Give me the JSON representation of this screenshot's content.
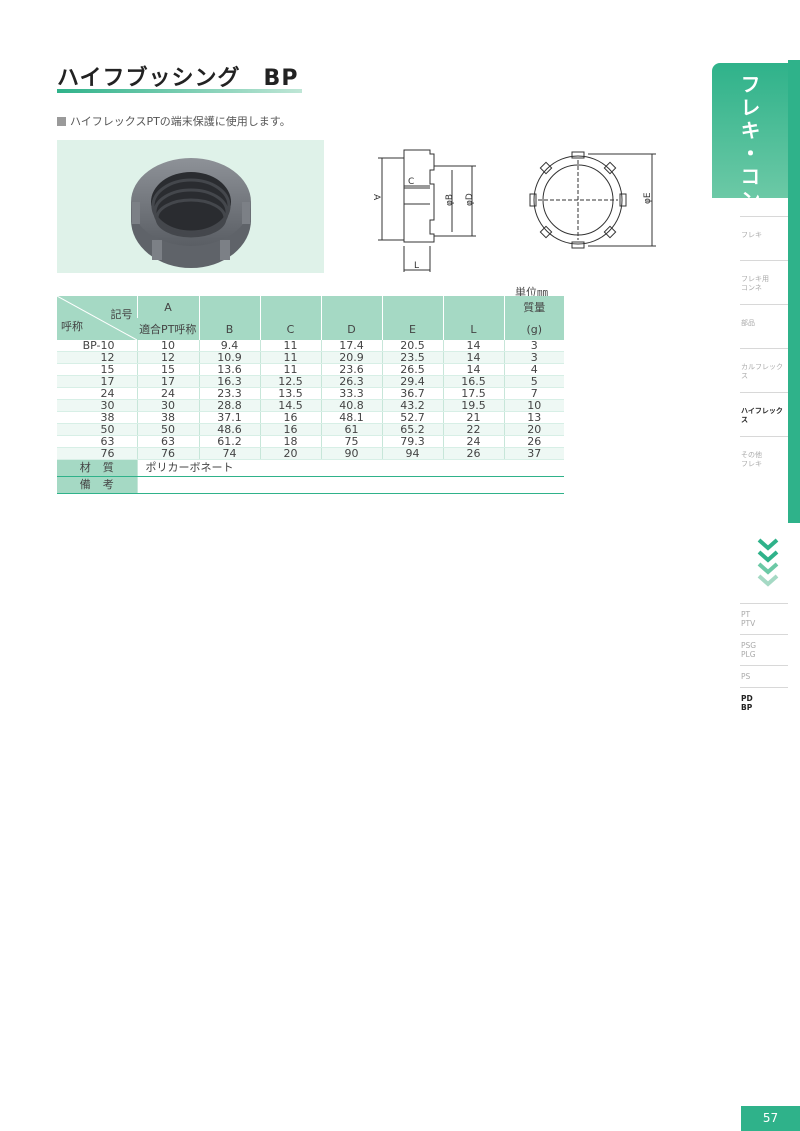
{
  "title": "ハイフブッシング　BP",
  "description": "ハイフレックスPTの端末保護に使用します。",
  "unit_label": "単位㎜",
  "dims": {
    "a": "A",
    "c": "C",
    "b": "φB",
    "d": "φD",
    "l": "L",
    "e": "φE"
  },
  "table": {
    "header_symbol": "記号",
    "header_nominal": "呼称",
    "col_a_top": "A",
    "col_a_bottom": "適合PT呼称",
    "cols": [
      "B",
      "C",
      "D",
      "E",
      "L"
    ],
    "weight_top": "質量",
    "weight_bottom": "(g)",
    "rows": [
      [
        "BP-10",
        "10",
        "9.4",
        "11",
        "17.4",
        "20.5",
        "14",
        "3"
      ],
      [
        "12",
        "12",
        "10.9",
        "11",
        "20.9",
        "23.5",
        "14",
        "3"
      ],
      [
        "15",
        "15",
        "13.6",
        "11",
        "23.6",
        "26.5",
        "14",
        "4"
      ],
      [
        "17",
        "17",
        "16.3",
        "12.5",
        "26.3",
        "29.4",
        "16.5",
        "5"
      ],
      [
        "24",
        "24",
        "23.3",
        "13.5",
        "33.3",
        "36.7",
        "17.5",
        "7"
      ],
      [
        "30",
        "30",
        "28.8",
        "14.5",
        "40.8",
        "43.2",
        "19.5",
        "10"
      ],
      [
        "38",
        "38",
        "37.1",
        "16",
        "48.1",
        "52.7",
        "21",
        "13"
      ],
      [
        "50",
        "50",
        "48.6",
        "16",
        "61",
        "65.2",
        "22",
        "20"
      ],
      [
        "63",
        "63",
        "61.2",
        "18",
        "75",
        "79.3",
        "24",
        "26"
      ],
      [
        "76",
        "76",
        "74",
        "20",
        "90",
        "94",
        "26",
        "37"
      ]
    ],
    "material_label": "材質",
    "material_value": "ポリカーボネート",
    "note_label": "備考",
    "note_value": ""
  },
  "side": {
    "tab_title": "フレキ・コンネ",
    "nav": [
      "フレキ",
      "フレキ用\nコンネ",
      "部品",
      "カルフレックス",
      "ハイフレックス",
      "その他\nフレキ"
    ],
    "nav_active_index": 4,
    "nav2": [
      "PT\nPTV",
      "PSG\nPLG",
      "PS",
      "PD\nBP"
    ],
    "nav2_active_index": 3
  },
  "page_number": "57",
  "colors": {
    "accent": "#2fb28a",
    "header_bg": "#a5d9c4",
    "photo_bg": "#dff2e9"
  }
}
